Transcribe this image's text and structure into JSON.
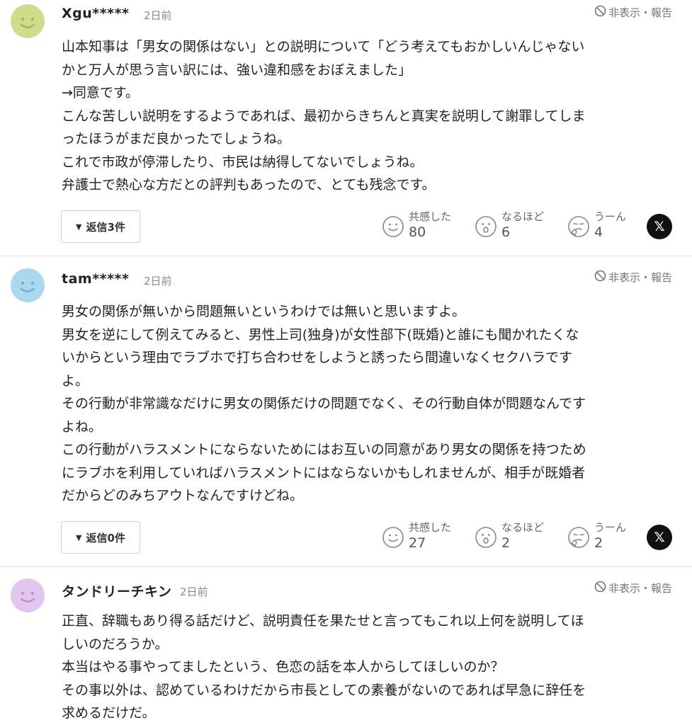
{
  "comments": [
    {
      "user": "Xgu*****",
      "time": "2日前",
      "hide_report": "非表示・報告",
      "avatar_color": "#cddd8a",
      "avatar_face_color": "#a5b850",
      "lines": [
        "山本知事は「男女の関係はない」との説明について「どう考えてもおかしいんじゃない",
        "かと万人が思う言い訳には、強い違和感をおぼえました」",
        "→同意です。",
        "こんな苦しい説明をするようであれば、最初からきちんと真実を説明して謝罪してしま",
        "ったほうがまだ良かったでしょうね。",
        "これで市政が停滞したり、市民は納得してないでしょうね。",
        "弁護士で熱心な方だとの評判もあったので、とても残念です。"
      ],
      "reply_label": "返信3件",
      "reactions": [
        {
          "label": "共感した",
          "count": "80",
          "icon": "smile-face-icon"
        },
        {
          "label": "なるほど",
          "count": "6",
          "icon": "surprised-face-icon"
        },
        {
          "label": "うーん",
          "count": "4",
          "icon": "thinking-face-icon"
        }
      ],
      "share_label": "𝕏"
    },
    {
      "user": "tam*****",
      "time": "2日前",
      "hide_report": "非表示・報告",
      "avatar_color": "#aad8ee",
      "avatar_face_color": "#6bb2d6",
      "lines": [
        "男女の関係が無いから問題無いというわけでは無いと思いますよ。",
        "男女を逆にして例えてみると、男性上司(独身)が女性部下(既婚)と誰にも聞かれたくな",
        "いからという理由でラブホで打ち合わせをしようと誘ったら間違いなくセクハラです",
        "よ。",
        "その行動が非常識なだけに男女の関係だけの問題でなく、その行動自体が問題なんです",
        "よね。",
        "この行動がハラスメントにならないためにはお互いの同意があり男女の関係を持つため",
        "にラブホを利用していればハラスメントにはならないかもしれませんが、相手が既婚者",
        "だからどのみちアウトなんですけどね。"
      ],
      "reply_label": "返信0件",
      "reactions": [
        {
          "label": "共感した",
          "count": "27",
          "icon": "smile-face-icon"
        },
        {
          "label": "なるほど",
          "count": "2",
          "icon": "surprised-face-icon"
        },
        {
          "label": "うーん",
          "count": "2",
          "icon": "thinking-face-icon"
        }
      ],
      "share_label": "𝕏"
    },
    {
      "user": "タンドリーチキン",
      "time": "2日前",
      "hide_report": "非表示・報告",
      "avatar_color": "#e2c6ee",
      "avatar_face_color": "#bf8fd6",
      "lines": [
        "正直、辞職もあり得る話だけど、説明責任を果たせと言ってもこれ以上何を説明してほ",
        "しいのだろうか。",
        "本当はやる事やってましたという、色恋の話を本人からしてほしいのか？",
        "その事以外は、認めているわけだから市長としての素養がないのであれば早急に辞任を",
        "求めるだけだ。"
      ]
    }
  ]
}
